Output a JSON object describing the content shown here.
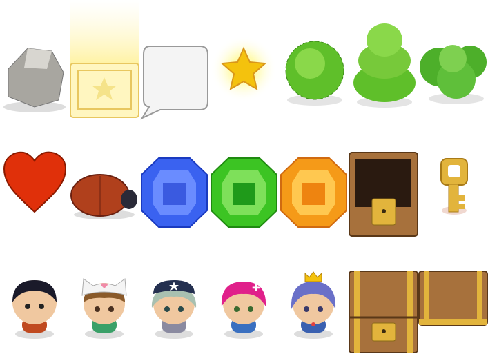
{
  "sheet": {
    "rows": [
      [
        "rock",
        "selector",
        "speech-bubble",
        "star",
        "tree-short",
        "tree-tall",
        "tree-ugly"
      ],
      [
        "heart",
        "enemy-bug",
        "gem-blue",
        "gem-green",
        "gem-orange",
        "chest-open",
        "key"
      ],
      [
        "character-boy",
        "character-cat-girl",
        "character-horn-girl",
        "character-pink-girl",
        "character-princess-girl",
        "chest-closed",
        "chest-lid"
      ]
    ]
  },
  "colors": {
    "rock": "#a8a6a0",
    "selector": "#fff3a6",
    "star": "#f4c20d",
    "tree": "#5fbf2a",
    "heart": "#e0300a",
    "bug": "#b0401c",
    "gem_blue": "#3a62f0",
    "gem_green": "#3cc423",
    "gem_orange": "#f59a18",
    "wood": "#a7713c",
    "brass": "#e2b43c"
  }
}
